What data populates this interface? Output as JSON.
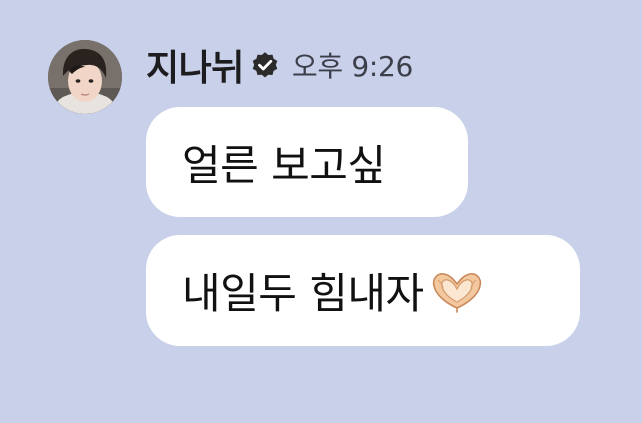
{
  "message": {
    "sender_name": "지나뉘",
    "verified_icon": "verified-badge-icon",
    "timestamp": "오후 9:26",
    "avatar_icon": "profile-avatar",
    "bubbles": [
      {
        "text": "얼른 보고싶"
      },
      {
        "text": "내일두 힘내자",
        "emoji_icon": "heart-hands-icon"
      }
    ]
  },
  "colors": {
    "background": "#c9d0ea",
    "bubble": "#ffffff",
    "text": "#111111",
    "timestamp": "#3c3f4a",
    "verified_badge": "#2b2b2b"
  }
}
